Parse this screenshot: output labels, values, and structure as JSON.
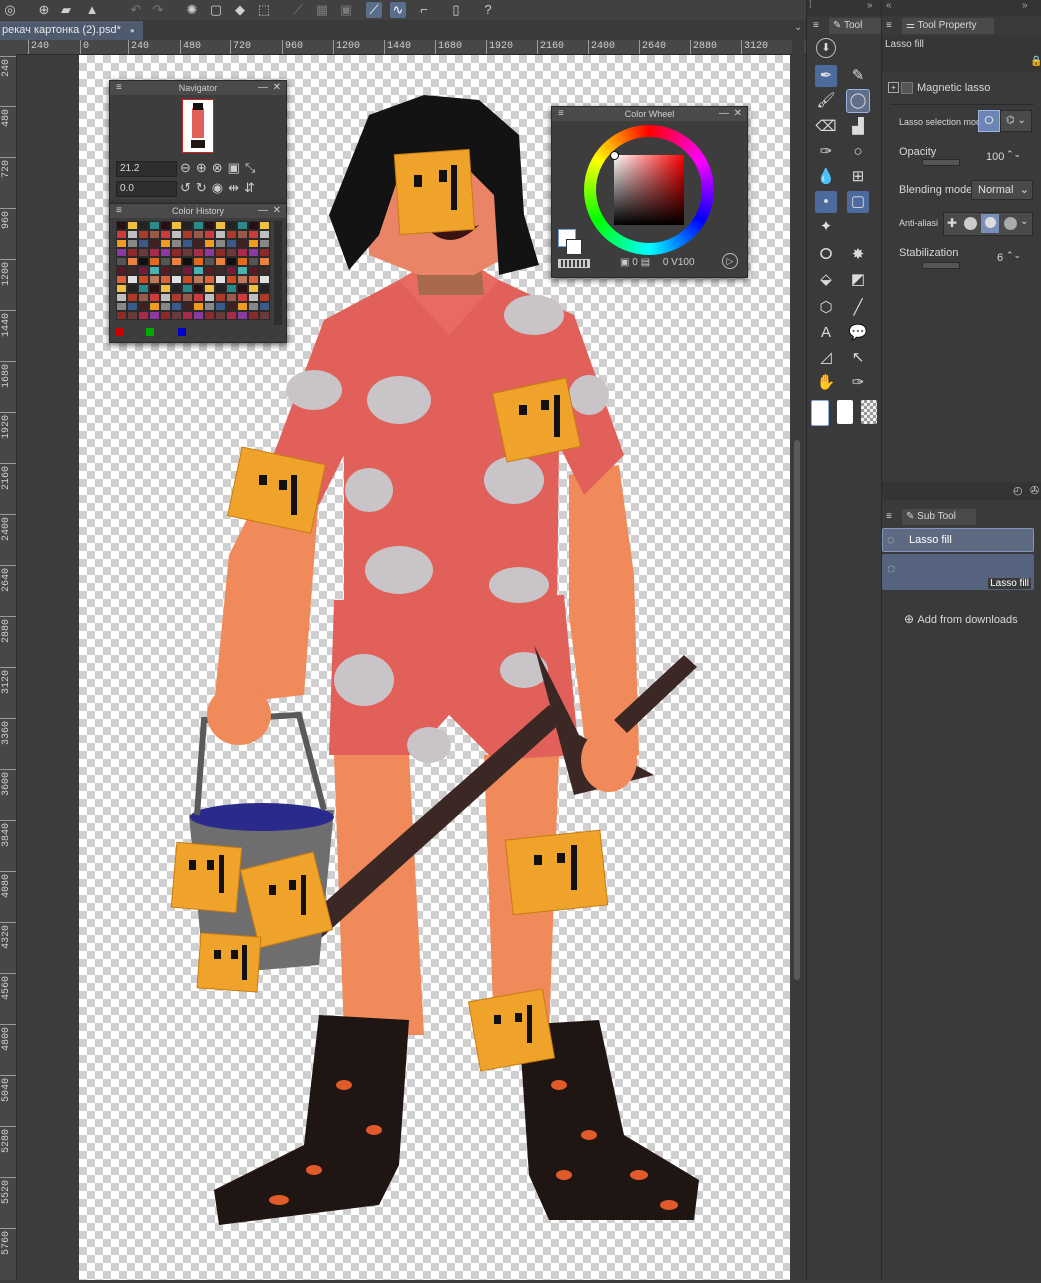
{
  "toolbar": {
    "icons": [
      "app-menu-icon",
      "new-file-icon",
      "open-folder-icon",
      "save-icon",
      "undo-icon",
      "redo-icon",
      "loading-icon",
      "fill-icon",
      "transform-icon",
      "snap-ruler-icon",
      "snap-grid-icon",
      "snap-special-icon",
      "lasso-active-icon",
      "curve-icon",
      "stroke-icon",
      "device-icon",
      "help-icon"
    ]
  },
  "document": {
    "tab_label": "рекач картонка (2).psd*",
    "modified_dot": "●"
  },
  "ruler": {
    "h_ticks": [
      "240",
      "0",
      "240",
      "480",
      "720",
      "960",
      "1200",
      "1440",
      "1680",
      "1920",
      "2160",
      "2400",
      "2640",
      "2880",
      "3120"
    ],
    "v_ticks": [
      "240",
      "480",
      "720",
      "960",
      "1200",
      "1440",
      "1680",
      "1920",
      "2160",
      "2400",
      "2640",
      "2880",
      "3120",
      "3360",
      "3600",
      "3840",
      "4080",
      "4320",
      "4560",
      "4800",
      "5040",
      "5280",
      "5520",
      "5760"
    ]
  },
  "navigator": {
    "title": "Navigator",
    "zoom_value": "21.2",
    "angle_value": "0.0"
  },
  "color_history": {
    "title": "Color History"
  },
  "color_wheel": {
    "title": "Color Wheel",
    "h_value": "0",
    "s_value": "0",
    "v_label": "V",
    "v_value": "100"
  },
  "tool_panel": {
    "tab_label": "Tool"
  },
  "tool_property": {
    "tab_label": "Tool Property",
    "subtool_name": "Lasso fill",
    "magnetic_lasso": "Magnetic lasso",
    "lasso_selection_mode": "Lasso selection mode",
    "opacity_label": "Opacity",
    "opacity_value": "100",
    "blending_label": "Blending mode",
    "blending_value": "Normal",
    "anti_alias_label": "Anti-aliasi",
    "stabilization_label": "Stabilization",
    "stabilization_value": "6"
  },
  "sub_tool": {
    "tab_label": "Sub Tool",
    "items": [
      "Lasso fill",
      "Lasso fill"
    ],
    "add_from_downloads": "Add from downloads"
  },
  "colors": {
    "accent": "#4d6a9c",
    "panel_bg": "#3a3a3a",
    "canvas_checker": "#cfcfcf"
  }
}
